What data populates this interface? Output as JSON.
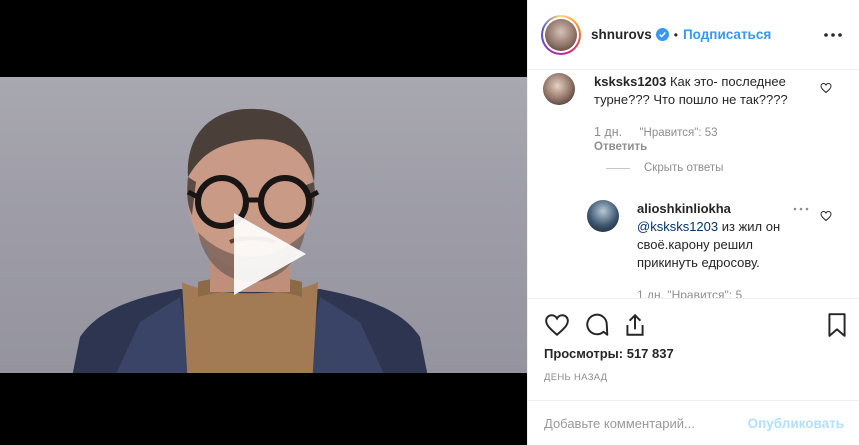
{
  "post": {
    "username": "shnurovs",
    "dot": "•",
    "follow_label": "Подписаться",
    "views_label": "Просмотры:",
    "views_count": "517 837",
    "posted_when": "ДЕНЬ НАЗАД"
  },
  "comments": [
    {
      "username": "ksksks1203",
      "text": "Как это- последнее турне??? Что пошло не так????",
      "time": "1 дн.",
      "likes_label": "\"Нравится\": 53",
      "reply_label": "Ответить",
      "hide_replies_label": "Скрыть ответы"
    }
  ],
  "replies": [
    {
      "username": "alioshkinliokha",
      "mention": "@ksksks1203",
      "text": "из жил он своё.карону решил прикинуть едросову.",
      "meta_partial": "1 дн.   \"Нравится\": 5"
    }
  ],
  "composer": {
    "placeholder": "Добавьте комментарий...",
    "publish_label": "Опубликовать"
  },
  "colors": {
    "accent": "#3897f0",
    "publish_disabled": "#b2dffc",
    "muted": "#8e8e8e"
  },
  "icons": [
    "verified-icon",
    "more-options-icon",
    "heart-icon",
    "comment-icon",
    "share-icon",
    "bookmark-icon",
    "play-icon"
  ]
}
